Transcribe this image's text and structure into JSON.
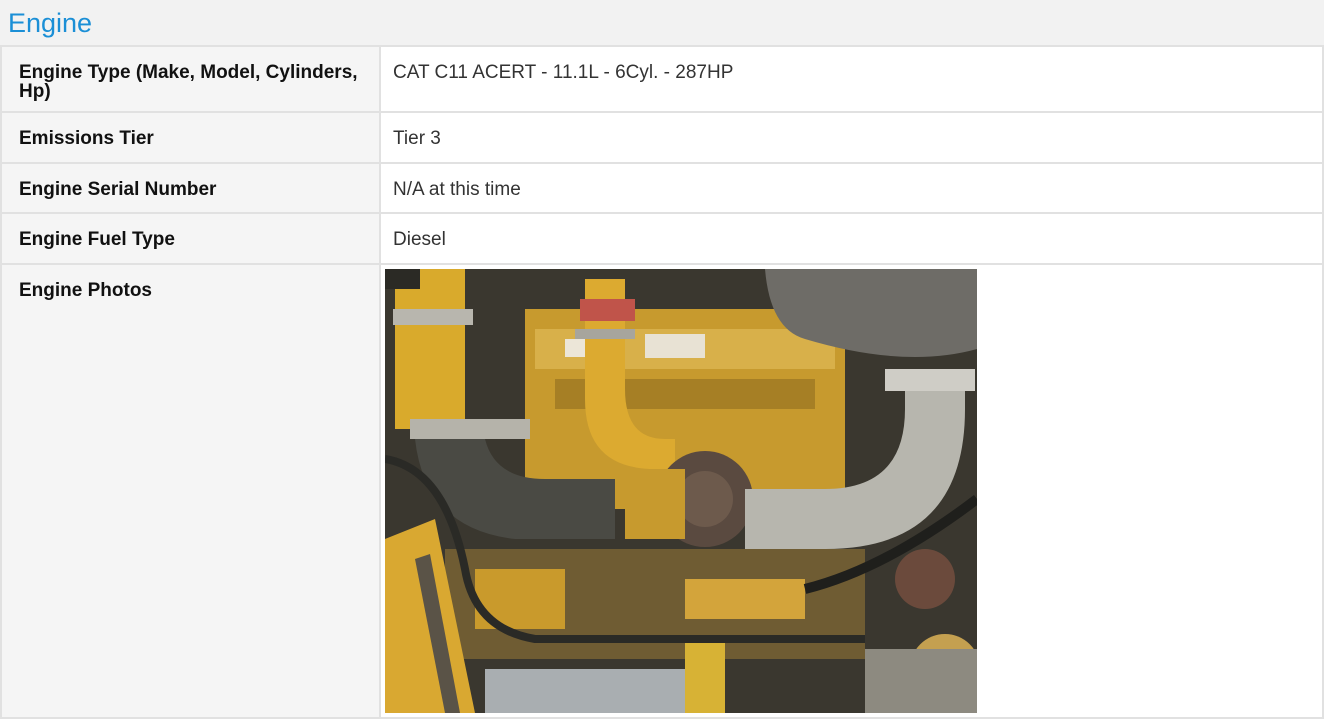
{
  "section": {
    "title": "Engine"
  },
  "rows": [
    {
      "label": "Engine Type (Make, Model, Cylinders, Hp)",
      "value": "CAT C11 ACERT - 11.1L - 6Cyl. - 287HP"
    },
    {
      "label": "Emissions Tier",
      "value": "Tier 3"
    },
    {
      "label": "Engine Serial Number",
      "value": "N/A at this time"
    },
    {
      "label": "Engine Fuel Type",
      "value": "Diesel"
    },
    {
      "label": "Engine Photos",
      "value": ""
    }
  ],
  "photo": {
    "icon": "engine-photo",
    "colors": {
      "engine": "#d8a733",
      "pipe": "#c9c9c3",
      "dark": "#2c2b26"
    }
  }
}
